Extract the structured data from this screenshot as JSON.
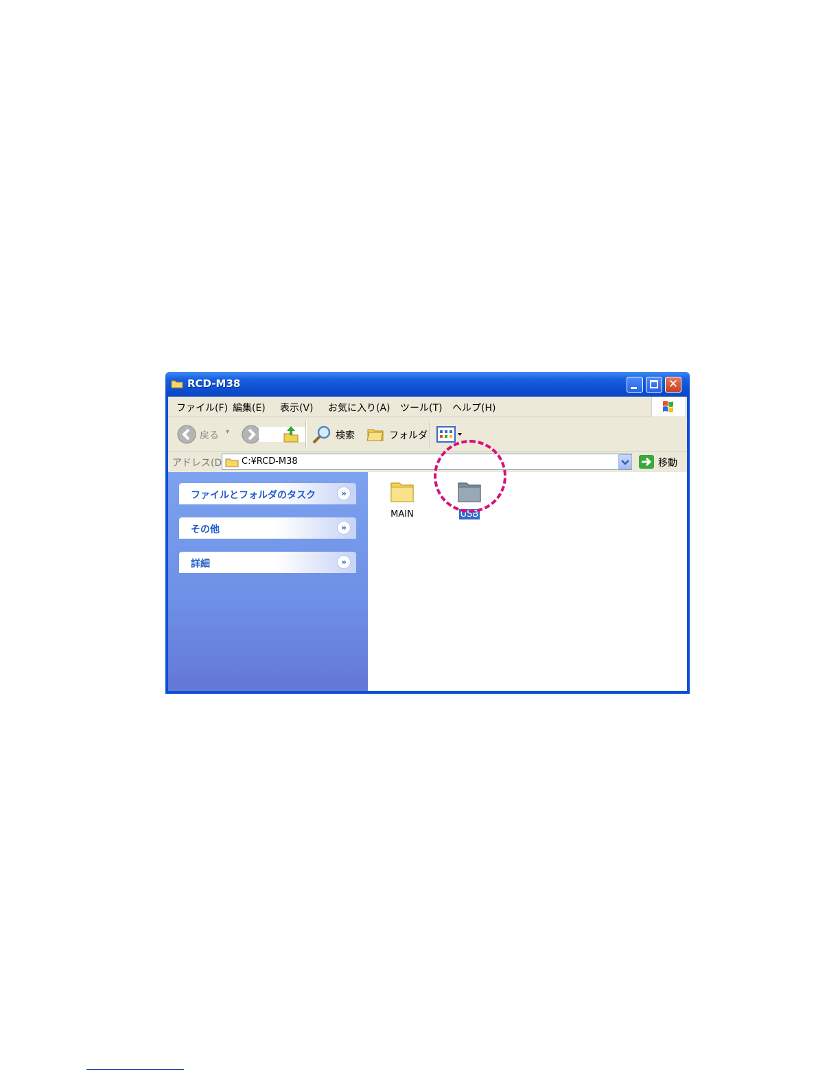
{
  "window": {
    "title": "RCD-M38"
  },
  "menu": [
    "ファイル(F)",
    "編集(E)",
    "表示(V)",
    "お気に入り(A)",
    "ツール(T)",
    "ヘルプ(H)"
  ],
  "toolbar": {
    "back_label": "戻る",
    "search_label": "検索",
    "folders_label": "フォルダ"
  },
  "address": {
    "label": "アドレス(D)",
    "value": "C:¥RCD-M38",
    "go_label": "移動"
  },
  "taskpane": {
    "sections": [
      {
        "title": "ファイルとフォルダのタスク"
      },
      {
        "title": "その他"
      },
      {
        "title": "詳細"
      }
    ]
  },
  "files": [
    {
      "name": "MAIN",
      "selected": false,
      "color": "#f3d45a"
    },
    {
      "name": "USB",
      "selected": true,
      "color": "#8a9aa6"
    }
  ],
  "colors": {
    "accent": "#0a4fd6",
    "highlight": "#d8107a",
    "selection": "#316ac5"
  }
}
